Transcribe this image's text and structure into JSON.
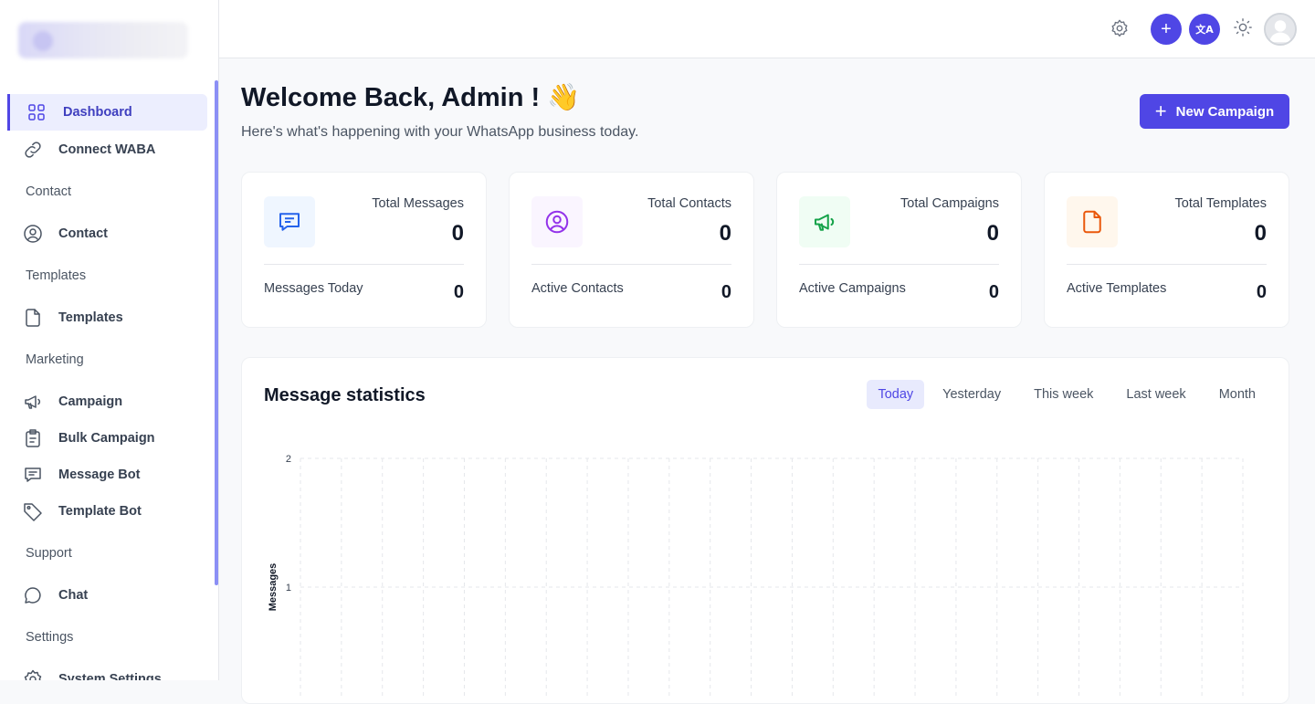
{
  "sidebar": {
    "items": [
      {
        "label": "Dashboard",
        "icon": "grid-icon",
        "active": true
      },
      {
        "label": "Connect WABA",
        "icon": "link-icon"
      },
      {
        "section": "Contact"
      },
      {
        "label": "Contact",
        "icon": "user-circle-icon"
      },
      {
        "section": "Templates"
      },
      {
        "label": "Templates",
        "icon": "document-icon"
      },
      {
        "section": "Marketing"
      },
      {
        "label": "Campaign",
        "icon": "megaphone-icon"
      },
      {
        "label": "Bulk Campaign",
        "icon": "clipboard-icon"
      },
      {
        "label": "Message Bot",
        "icon": "chat-bubble-icon"
      },
      {
        "label": "Template Bot",
        "icon": "tag-icon"
      },
      {
        "section": "Support"
      },
      {
        "label": "Chat",
        "icon": "chat-circle-icon"
      },
      {
        "section": "Settings"
      },
      {
        "label": "System Settings",
        "icon": "gear-icon"
      }
    ]
  },
  "topbar": {
    "icons": [
      "gear-icon",
      "plus-icon",
      "translate-icon",
      "sun-icon",
      "avatar"
    ],
    "translate_glyph": "文A"
  },
  "header": {
    "title": "Welcome Back, Admin ! 👋",
    "subtitle": "Here's what's happening with your WhatsApp business today.",
    "new_campaign_label": "New Campaign"
  },
  "cards": [
    {
      "title": "Total Messages",
      "value": "0",
      "sub_label": "Messages Today",
      "sub_value": "0",
      "icon": "message-icon",
      "color": "#2563eb",
      "bg": "#eff6ff"
    },
    {
      "title": "Total Contacts",
      "value": "0",
      "sub_label": "Active Contacts",
      "sub_value": "0",
      "icon": "user-circle-icon",
      "color": "#9333ea",
      "bg": "#faf5ff"
    },
    {
      "title": "Total Campaigns",
      "value": "0",
      "sub_label": "Active Campaigns",
      "sub_value": "0",
      "icon": "megaphone-icon",
      "color": "#16a34a",
      "bg": "#f0fdf4"
    },
    {
      "title": "Total Templates",
      "value": "0",
      "sub_label": "Active Templates",
      "sub_value": "0",
      "icon": "document-icon",
      "color": "#ea580c",
      "bg": "#fff7ed"
    }
  ],
  "stats": {
    "title": "Message statistics",
    "tabs": [
      "Today",
      "Yesterday",
      "This week",
      "Last week",
      "Month"
    ],
    "active_tab": "Today"
  },
  "chart_data": {
    "type": "line",
    "ylabel": "Messages",
    "ylim": [
      0,
      2
    ],
    "yticks": [
      "2",
      "1"
    ],
    "grid": true,
    "series": [
      {
        "values": []
      }
    ]
  },
  "colors": {
    "accent": "#4f46e5"
  }
}
